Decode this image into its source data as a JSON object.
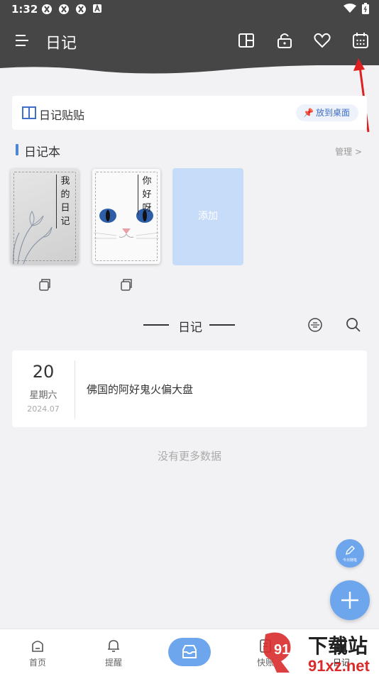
{
  "status_bar": {
    "time": "1:32"
  },
  "header": {
    "title": "日记"
  },
  "sticker": {
    "label": "日记贴贴",
    "pin_button": "放到桌面"
  },
  "notebooks": {
    "title": "日记本",
    "manage": "管理 >",
    "items": [
      {
        "cover_title": "我的日记"
      },
      {
        "cover_title": "你好呀"
      }
    ],
    "add_label": "添加"
  },
  "diary": {
    "heading": "日记",
    "entries": [
      {
        "day": "20",
        "weekday": "星期六",
        "year_month": "2024.07",
        "content": "佛国的阿好鬼火偏大盘"
      }
    ],
    "no_more": "没有更多数据"
  },
  "fab": {
    "mini_label": "今日随笔"
  },
  "bottom_nav": {
    "items": [
      {
        "label": "首页"
      },
      {
        "label": "提醒"
      },
      {
        "label": "快账"
      },
      {
        "label": "日记"
      }
    ]
  },
  "watermark": {
    "brand": "下载站",
    "domain": "91xz.net"
  },
  "colors": {
    "header": "#464646",
    "accent": "#6ea6ee",
    "add_card": "#c6dcf8",
    "annotation_arrow": "#e02020"
  }
}
